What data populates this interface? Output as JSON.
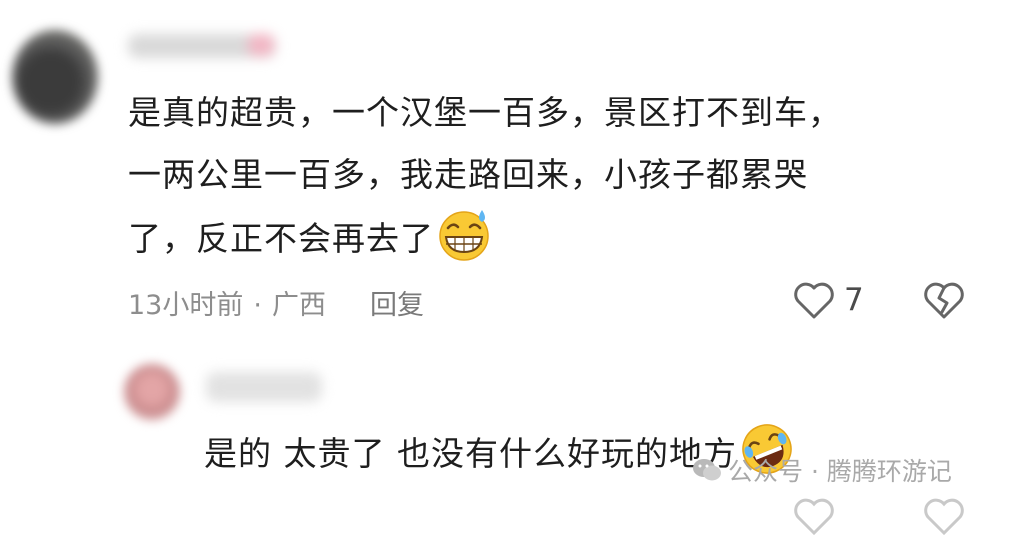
{
  "comments": [
    {
      "text_lines": [
        "是真的超贵，一个汉堡一百多，景区打不到车，",
        "一两公里一百多，我走路回来，小孩子都累哭",
        "了，反正不会再去了"
      ],
      "emoji": "sweat-grin-emoji",
      "time": "13小时前",
      "separator": "·",
      "location": "广西",
      "reply_label": "回复",
      "likes": "7"
    },
    {
      "text": "是的 太贵了 也没有什么好玩的地方",
      "emoji": "rofl-emoji"
    }
  ],
  "watermark": {
    "text": "公众号 · 腾腾环游记",
    "icon": "wechat-icon"
  },
  "colors": {
    "text": "#1e1e1e",
    "meta": "#8d8d8d",
    "watermark": "#a9a9a9"
  }
}
